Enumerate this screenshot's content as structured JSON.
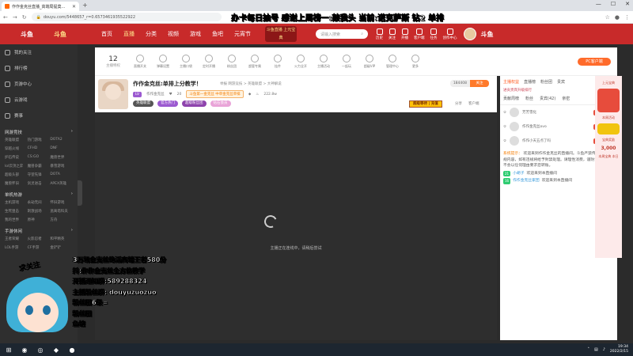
{
  "browser": {
    "tab_title": "作作金克丝直播_高端局提莫…",
    "url": "douyu.com/5448657_r=0.65734619355229​22"
  },
  "overlay_banner": "办卡每日抽号 感谢上周榜一:敲我头 当前:诺克萨斯 钻2 单排",
  "site": {
    "logo": "斗鱼",
    "sublogo": "斗鱼",
    "nav": [
      "首页",
      "直播",
      "分类",
      "视频",
      "游戏",
      "鱼吧",
      "元宵节"
    ],
    "badge": "斗鱼直播 上元宝典",
    "search_placeholder": "请输入搜索",
    "header_icons": [
      "历史",
      "关注",
      "开播",
      "客户端",
      "任务",
      "创作中心"
    ],
    "brand": "斗鱼"
  },
  "sidebar": {
    "items": [
      "我的关注",
      "排行榜",
      "页游中心",
      "云游戏",
      "赛事"
    ],
    "section1": "网游竞技",
    "grid1": [
      "英雄联盟",
      "热门游戏",
      "DOTA2",
      "穿越火线",
      "CFHD",
      "DNF",
      "炉石传说",
      "CS:GO",
      "魔兽世界",
      "lol云顶之弈",
      "魔兽争霸",
      "暴雪游戏",
      "超级头部",
      "守望先锋",
      "DOTA",
      "魔兽怀旧",
      "剑灵进击",
      "APEX英雄"
    ],
    "section2": "单机热游",
    "grid2": [
      "主机游戏",
      "永劫无间",
      "怀旧游戏",
      "生死狙击",
      "刺激战场",
      "逃离塔科夫",
      "我的世界",
      "原神",
      "方舟"
    ],
    "section3": "手游休闲",
    "grid3": [
      "王者荣耀",
      "火影忍者",
      "和平精英",
      "LOL手游",
      "CF手游",
      "金铲铲"
    ]
  },
  "roomtool": {
    "level": "12",
    "level_label": "主播特权",
    "tools": [
      "直播开关",
      "弹幕设置",
      "主播口袋",
      "定时开播",
      "粉丝团",
      "超管专属",
      "挂件",
      "火力全开",
      "主播活动",
      "一起玩",
      "超级VIP",
      "管理中心",
      "更多"
    ],
    "pc_button": "PC客户端"
  },
  "room": {
    "title": "作作金克丝:单排上分教学！",
    "meta": "举报 网游竞技 > 英雄联盟 > 大神解说",
    "level_tag": "LV",
    "name": "作作金克丝",
    "fans": "20",
    "charity": "斗鱼第一金克丝 中单金克丝单排",
    "heat": "222.8w",
    "pills": [
      "英雄联盟",
      "官方热门",
      "超级粉丝团",
      "钻石会员"
    ],
    "follow_count": "184408",
    "follow_label": "关注",
    "gift_button": "超级等待 | 充值",
    "share": "分享",
    "client": "客户端"
  },
  "player": {
    "loading_text": "主播正在连线中，请稍后尝试"
  },
  "rightpanel": {
    "tabs": [
      "主播权益",
      "直播榜",
      "粉丝团",
      "贵宾"
    ],
    "sub": "进贡贵宾升级排行",
    "tabs2": [
      "贡献周榜",
      "粉丝",
      "贵宾(42)",
      "亲密"
    ],
    "ranks": [
      {
        "name": "芳芳雪化",
        "tag": "点亮宝"
      },
      {
        "name": "作作金克丝ovo",
        "tag": "点亮宝"
      },
      {
        "name": "作作小天五点了吗",
        "tag": "点亮宝"
      }
    ],
    "system_label": "系统提示：",
    "system_text": "欢迎来到作作金克丝的直播间。斗鱼严禁传播违法违规内容，如有违规将给予封禁处理。请理性消费，谨防诈骗，主播不会以任何理由要求您转账。",
    "chat": [
      {
        "lvl": "21",
        "user": "小胡子",
        "text": "欢迎来到本直播间"
      },
      {
        "lvl": "16",
        "user": "作作金克丝家团",
        "text": "欢迎来到本直播间"
      }
    ]
  },
  "adcol": {
    "title": "上元宝典",
    "tag1": "本周活动",
    "tag2": "宝典奖励",
    "amount": "3,000",
    "bottom": "本周宝典 本日"
  },
  "stream_overlay": [
    "3万场金克丝绝活高端王者580分",
    "抖:作作金克丝全方位教学",
    "开播通知群:589288324",
    "主播粉丝群: douyuzuozuo",
    "粉丝团6级=",
    "粉丝团",
    "鱼塘"
  ],
  "anime_speech": "求关注",
  "taskbar": {
    "time": "19:34",
    "date": "2022/2/15"
  },
  "colors": {
    "brand_red": "#c82a2a",
    "accent_orange": "#ff6b2b"
  }
}
